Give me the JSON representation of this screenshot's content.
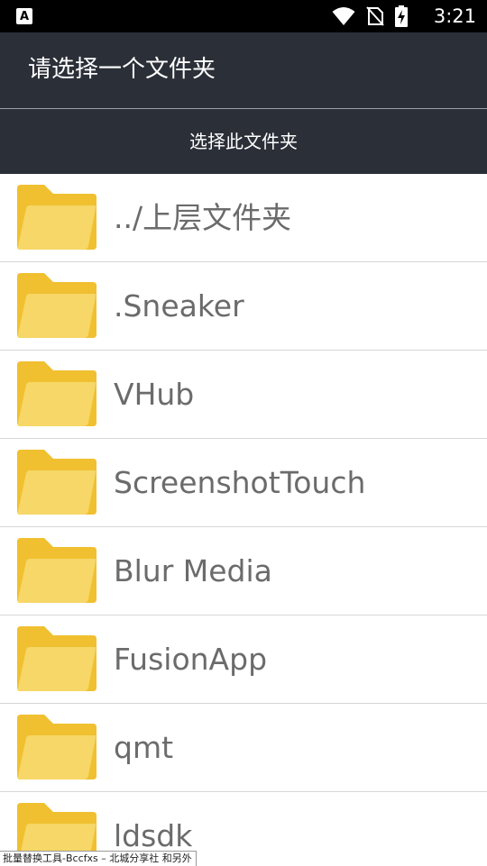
{
  "status_bar": {
    "left_icon_letter": "A",
    "time": "3:21",
    "icons": [
      "wifi-icon",
      "no-sim-icon",
      "battery-charging-icon"
    ]
  },
  "header": {
    "title": "请选择一个文件夹"
  },
  "action": {
    "label": "选择此文件夹"
  },
  "folders": [
    {
      "label": "../上层文件夹",
      "icon": "folder-icon"
    },
    {
      "label": ".Sneaker",
      "icon": "folder-icon"
    },
    {
      "label": "VHub",
      "icon": "folder-icon"
    },
    {
      "label": "ScreenshotTouch",
      "icon": "folder-icon"
    },
    {
      "label": "Blur Media",
      "icon": "folder-icon"
    },
    {
      "label": "FusionApp",
      "icon": "folder-icon"
    },
    {
      "label": "qmt",
      "icon": "folder-icon"
    },
    {
      "label": "ldsdk",
      "icon": "folder-icon"
    }
  ],
  "toast": {
    "text": "批量替换工具-Bccfxs – 北城分享社 和另外"
  },
  "colors": {
    "header_bg": "#2b2f38",
    "folder_back": "#f0c030",
    "folder_front": "#f6d767",
    "label_gray": "#6b6b6b"
  }
}
